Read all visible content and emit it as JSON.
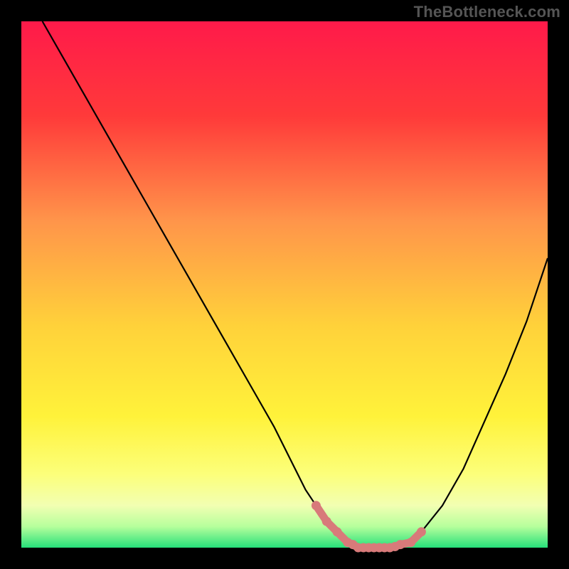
{
  "watermark": {
    "text": "TheBottleneck.com"
  },
  "chart_data": {
    "type": "line",
    "title": "",
    "xlabel": "",
    "ylabel": "",
    "xlim": [
      0,
      100
    ],
    "ylim": [
      0,
      100
    ],
    "grid": false,
    "gradient_stops": [
      {
        "offset": 0,
        "color": "#ff1a4a"
      },
      {
        "offset": 18,
        "color": "#ff3a3a"
      },
      {
        "offset": 38,
        "color": "#ff954a"
      },
      {
        "offset": 58,
        "color": "#ffd23a"
      },
      {
        "offset": 75,
        "color": "#fff23a"
      },
      {
        "offset": 86,
        "color": "#fcff7a"
      },
      {
        "offset": 92,
        "color": "#f2ffb2"
      },
      {
        "offset": 96,
        "color": "#b6ff9c"
      },
      {
        "offset": 100,
        "color": "#26e07a"
      }
    ],
    "series": [
      {
        "name": "bottleneck-curve",
        "x": [
          4,
          8,
          12,
          16,
          20,
          24,
          28,
          32,
          36,
          40,
          44,
          48,
          50,
          52,
          54,
          56,
          58,
          60,
          62,
          64,
          66,
          68,
          70,
          72,
          74,
          76,
          80,
          84,
          88,
          92,
          96,
          100
        ],
        "y": [
          100,
          93,
          86,
          79,
          72,
          65,
          58,
          51,
          44,
          37,
          30,
          23,
          19,
          15,
          11,
          8,
          5,
          3,
          1,
          0,
          0,
          0,
          0,
          0,
          1,
          3,
          8,
          15,
          24,
          33,
          43,
          55
        ]
      }
    ],
    "highlight": {
      "name": "min-plateau",
      "color": "#d87a7a",
      "points_x": [
        56,
        58,
        60,
        62,
        63,
        64,
        65,
        66,
        67,
        68,
        69,
        70,
        71,
        72,
        74,
        76
      ],
      "points_y": [
        8,
        5,
        3,
        1,
        0.6,
        0,
        0,
        0,
        0,
        0,
        0,
        0,
        0.2,
        0.6,
        1,
        3
      ]
    }
  }
}
